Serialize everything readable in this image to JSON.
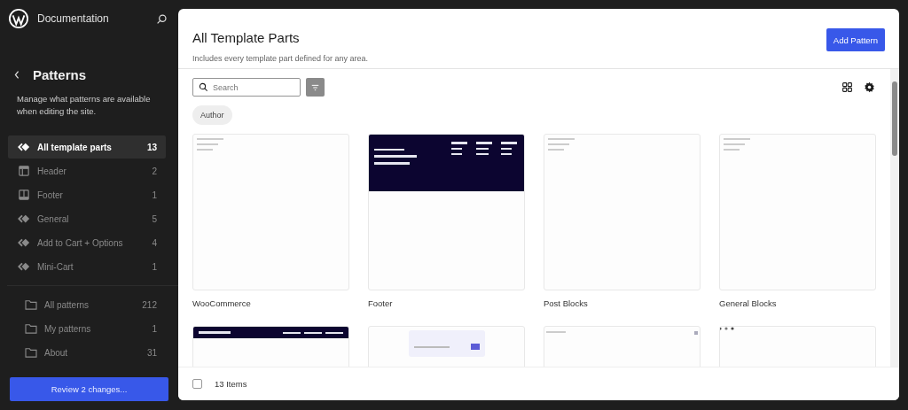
{
  "site": {
    "title": "Documentation"
  },
  "sidebar": {
    "title": "Patterns",
    "description": "Manage what patterns are available when editing the site.",
    "template_parts": [
      {
        "label": "All template parts",
        "count": "13",
        "kind": "parts",
        "selected": true
      },
      {
        "label": "Header",
        "count": "2",
        "kind": "header",
        "selected": false
      },
      {
        "label": "Footer",
        "count": "1",
        "kind": "footer",
        "selected": false
      },
      {
        "label": "General",
        "count": "5",
        "kind": "parts",
        "selected": false
      },
      {
        "label": "Add to Cart + Options",
        "count": "4",
        "kind": "parts",
        "selected": false
      },
      {
        "label": "Mini-Cart",
        "count": "1",
        "kind": "parts",
        "selected": false
      }
    ],
    "categories": [
      {
        "label": "All patterns",
        "count": "212",
        "selected": false
      },
      {
        "label": "My patterns",
        "count": "1",
        "selected": false
      },
      {
        "label": "About",
        "count": "31",
        "selected": false
      }
    ],
    "review_button": "Review 2 changes..."
  },
  "main": {
    "title": "All Template Parts",
    "description": "Includes every template part defined for any area.",
    "add_button": "Add Pattern",
    "search": {
      "placeholder": "Search"
    },
    "filter_chip": "Author",
    "patterns": [
      {
        "title": "WooCommerce",
        "preview": {
          "kind": "blank"
        }
      },
      {
        "title": "Footer",
        "preview": {
          "kind": "footer"
        }
      },
      {
        "title": "Post Blocks",
        "preview": {
          "kind": "blank"
        }
      },
      {
        "title": "General Blocks",
        "preview": {
          "kind": "blank"
        }
      },
      {
        "preview": {
          "kind": "header"
        }
      },
      {
        "preview": {
          "kind": "search"
        }
      },
      {
        "preview": {
          "kind": "text"
        }
      },
      {
        "preview": {
          "kind": "dots"
        }
      }
    ],
    "footer": {
      "checked": false,
      "count": "13 Items"
    }
  }
}
